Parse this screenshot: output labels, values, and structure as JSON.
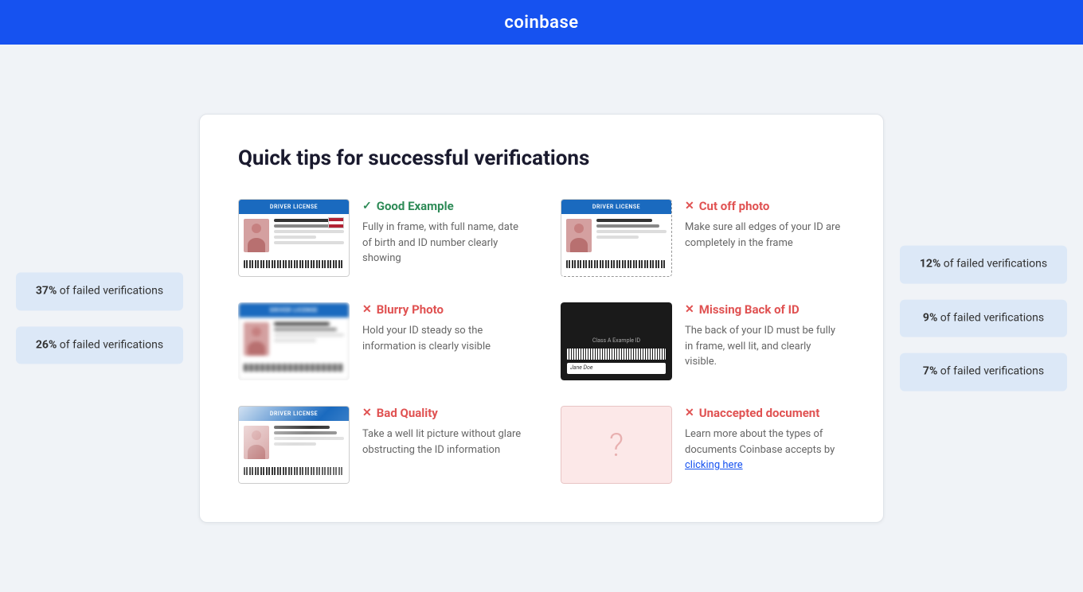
{
  "header": {
    "logo": "coinbase"
  },
  "card": {
    "title": "Quick tips for successful verifications"
  },
  "left_badges": [
    {
      "percent": "37%",
      "label": "of failed verifications"
    },
    {
      "percent": "26%",
      "label": "of failed verifications"
    }
  ],
  "right_badges": [
    {
      "percent": "12%",
      "label": "of failed verifications"
    },
    {
      "percent": "9%",
      "label": "of failed verifications"
    },
    {
      "percent": "7%",
      "label": "of failed verifications"
    }
  ],
  "tips": [
    {
      "id": "good-example",
      "type": "success",
      "icon": "✓",
      "title": "Good Example",
      "description": "Fully in frame, with full name, date of birth and ID number clearly showing",
      "image_type": "id-good"
    },
    {
      "id": "cut-off",
      "type": "error",
      "icon": "✕",
      "title": "Cut off photo",
      "description": "Make sure all edges of your ID are completely in the frame",
      "image_type": "id-cutoff"
    },
    {
      "id": "blurry",
      "type": "error",
      "icon": "✕",
      "title": "Blurry Photo",
      "description": "Hold your ID steady so the information is clearly visible",
      "image_type": "id-blurry"
    },
    {
      "id": "missing-back",
      "type": "error",
      "icon": "✕",
      "title": "Missing Back of ID",
      "description": "The back of your ID must be fully in frame, well lit, and clearly visible.",
      "image_type": "id-back"
    },
    {
      "id": "bad-quality",
      "type": "error",
      "icon": "✕",
      "title": "Bad Quality",
      "description": "Take a well lit picture without glare obstructing the ID information",
      "image_type": "id-bad"
    },
    {
      "id": "unaccepted",
      "type": "error",
      "icon": "✕",
      "title": "Unaccepted document",
      "description": "Learn more about the types of documents Coinbase accepts by",
      "link_text": "clicking here",
      "image_type": "id-unknown"
    }
  ],
  "id_card_header": "DRIVER LICENSE",
  "id_card_back_label": "Class A Example ID"
}
